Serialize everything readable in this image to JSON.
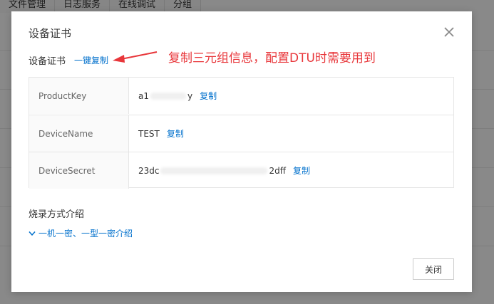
{
  "background": {
    "tabs": [
      "文件管理",
      "日志服务",
      "在线调试",
      "分组"
    ]
  },
  "modal": {
    "title": "设备证书",
    "section_label": "设备证书",
    "copy_all_label": "一键复制",
    "annotation_text": "复制三元组信息，配置DTU时需要用到",
    "rows": [
      {
        "key": "ProductKey",
        "value_start": "a1",
        "value_end": "y",
        "copy_label": "复制"
      },
      {
        "key": "DeviceName",
        "value_start": "TEST",
        "value_end": "",
        "copy_label": "复制"
      },
      {
        "key": "DeviceSecret",
        "value_start": "23dc",
        "value_end": "2dff",
        "copy_label": "复制"
      }
    ],
    "burn_title": "烧录方式介绍",
    "burn_link": "一机一密、一型一密介绍",
    "close_button": "关闭"
  },
  "colors": {
    "link": "#0070cc",
    "annotation": "#e8363a"
  }
}
